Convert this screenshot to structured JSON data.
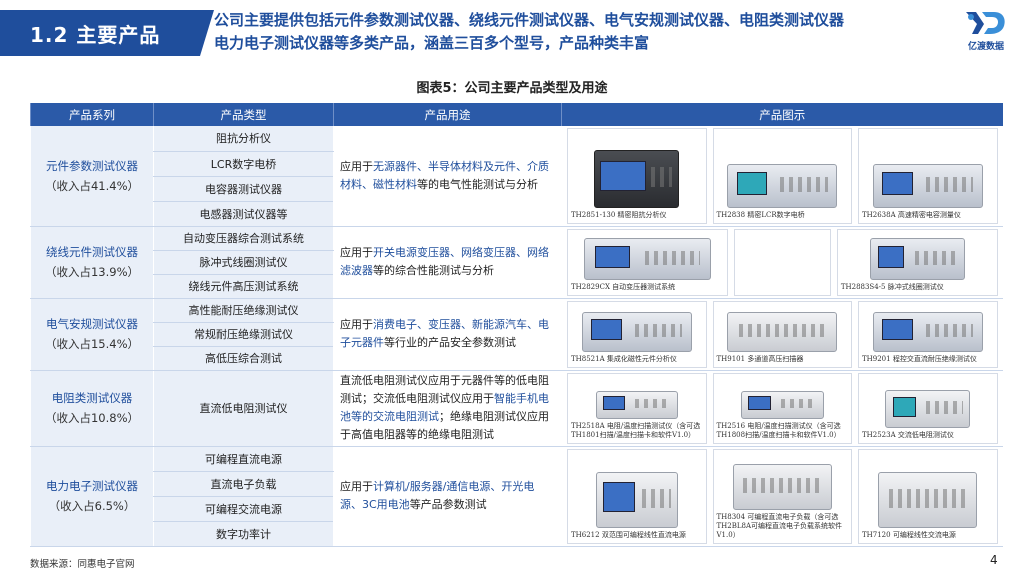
{
  "header": {
    "section": "1.2 主要产品",
    "headline_line1": "公司主要提供包括元件参数测试仪器、绕线元件测试仪器、电气安规测试仪器、电阻类测试仪器",
    "headline_line2": "电力电子测试仪器等多类产品，涵盖三百多个型号，产品种类丰富",
    "logo_text": "亿渡数据"
  },
  "caption": "图表5：公司主要产品类型及用途",
  "table": {
    "headers": [
      "产品系列",
      "产品类型",
      "产品用途",
      "产品图示"
    ],
    "rows": [
      {
        "series": "元件参数测试仪器",
        "share": "（收入占41.4%）",
        "types": [
          "阻抗分析仪",
          "LCR数字电桥",
          "电容器测试仪器",
          "电感器测试仪器等"
        ],
        "use_pre": "应用于",
        "use_hl": "无源器件、半导体材料及元件、介质材料、磁性材料",
        "use_post": "等的电气性能测试与分析",
        "images": [
          "TH2851-130 精密阻抗分析仪",
          "TH2838 精密LCR数字电桥",
          "TH2638A 高速精密电容测量仪"
        ]
      },
      {
        "series": "绕线元件测试仪器",
        "share": "（收入占13.9%）",
        "types": [
          "自动变压器综合测试系统",
          "脉冲式线圈测试仪",
          "绕线元件高压测试系统"
        ],
        "use_pre": "应用于",
        "use_hl": "开关电源变压器、网络变压器、网络滤波器",
        "use_post": "等的综合性能测试与分析",
        "images": [
          "TH2829CX 自动变压器测试系统",
          "TH2883S4-5 脉冲式线圈测试仪"
        ]
      },
      {
        "series": "电气安规测试仪器",
        "share": "（收入占15.4%）",
        "types": [
          "高性能耐压绝缘测试仪",
          "常规耐压绝缘测试仪",
          "高低压综合测试"
        ],
        "use_pre": "应用于",
        "use_hl": "消费电子、变压器、新能源汽车、电子元器件",
        "use_post": "等行业的产品安全参数测试",
        "images": [
          "TH8521A 集成化磁性元件分析仪",
          "TH9101 多通道高压扫描器",
          "TH9201 程控交直流耐压绝缘测试仪"
        ]
      },
      {
        "series": "电阻类测试仪器",
        "share": "（收入占10.8%）",
        "types": [
          "直流低电阻测试仪"
        ],
        "use_pre": "直流低电阻测试仪应用于元器件等的低电阻测试；交流低电阻测试仪应用于",
        "use_hl": "智能手机电池等的交流电阻测试",
        "use_post": "；绝缘电阻测试仪应用于高值电阻器等的绝缘电阻测试",
        "images": [
          "TH2518A 电阻/温度扫描测试仪（含可选TH1801扫描/温度扫描卡和软件V1.0）",
          "TH2516 电阻/温度扫描测试仪（含可选TH1808扫描/温度扫描卡和软件V1.0）",
          "TH2523A 交流低电阻测试仪"
        ]
      },
      {
        "series": "电力电子测试仪器",
        "share": "（收入占6.5%）",
        "types": [
          "可编程直流电源",
          "直流电子负载",
          "可编程交流电源",
          "数字功率计"
        ],
        "use_pre": "应用于",
        "use_hl": "计算机/服务器/通信电源、开光电源、3C用电池",
        "use_post": "等产品参数测试",
        "images": [
          "TH6212 双范围可编程线性直流电源",
          "TH8304 可编程直流电子负载（含可选TH2BL8A可编程直流电子负载系统软件V1.0）",
          "TH7120 可编程线性交流电源"
        ]
      }
    ]
  },
  "footer": {
    "source": "数据来源：同惠电子官网",
    "page": "4"
  },
  "colors": {
    "brand_blue": "#1f4e9c",
    "header_blue": "#2b5aa8",
    "row_tint": "#e9eff8"
  }
}
